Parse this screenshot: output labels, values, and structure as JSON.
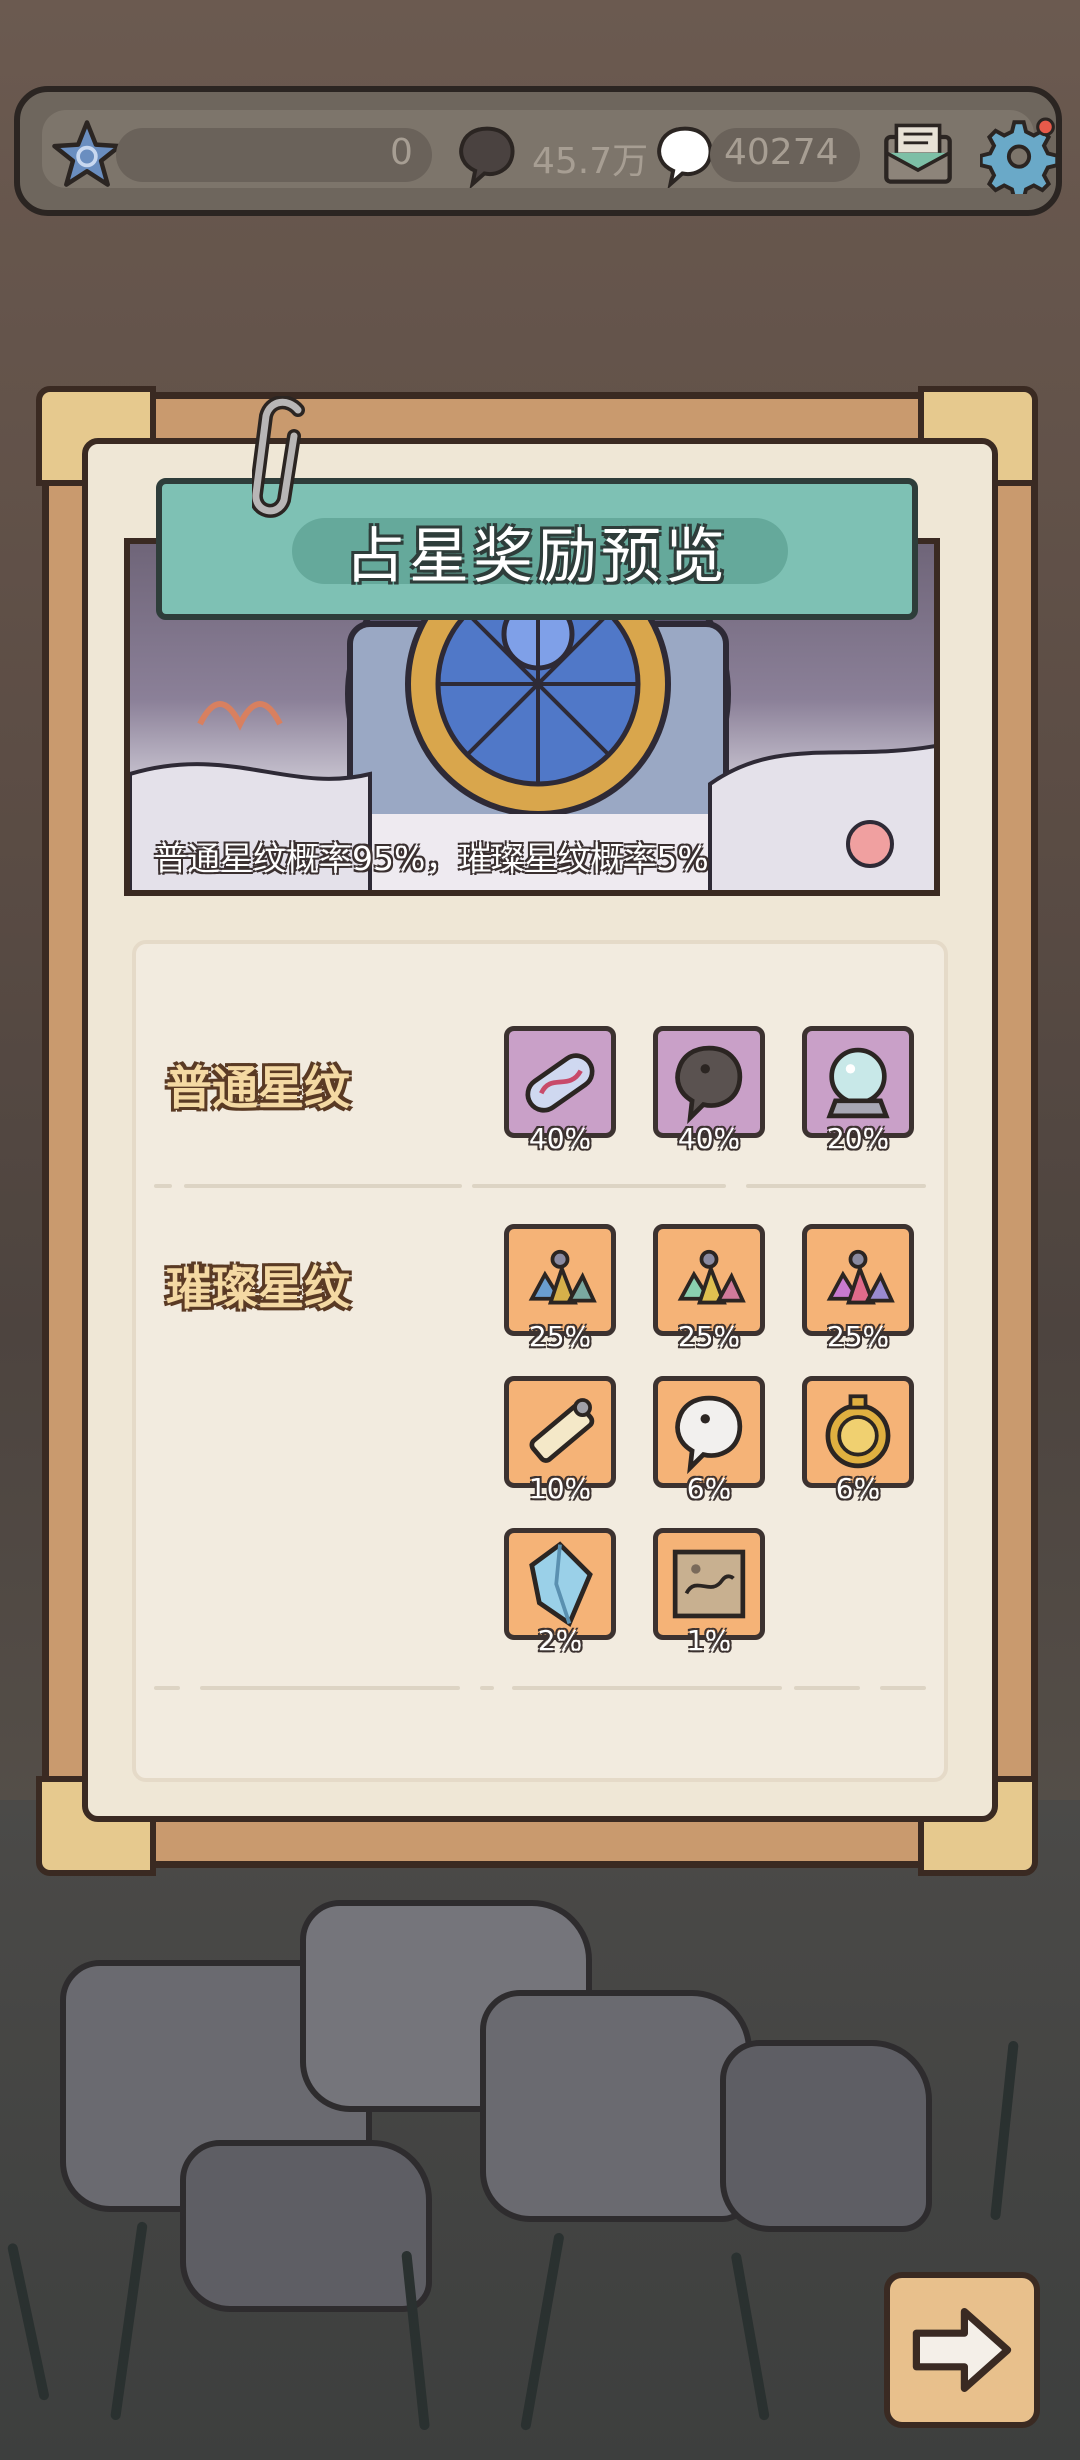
{
  "topbar": {
    "star_count": "0",
    "currency_1": "45.7万",
    "currency_2": "40274",
    "icons": [
      "star-icon",
      "speech-bubble-icon",
      "speech-bubble-icon",
      "mail-icon",
      "gear-icon"
    ]
  },
  "panel": {
    "title": "占星奖励预览",
    "caption": "普通星纹概率95%，璀璨星纹概率5%",
    "rows": [
      {
        "label": "普通星纹",
        "items": [
          {
            "icon": "bandage-icon",
            "percent": "40%"
          },
          {
            "icon": "dark-bubble-icon",
            "percent": "40%"
          },
          {
            "icon": "crystal-ball-icon",
            "percent": "20%"
          }
        ]
      },
      {
        "label": "璀璨星纹",
        "items": [
          {
            "icon": "gem-cluster-icon",
            "percent": "25%"
          },
          {
            "icon": "gem-cluster-icon",
            "percent": "25%"
          },
          {
            "icon": "gem-cluster-icon",
            "percent": "25%"
          },
          {
            "icon": "tube-icon",
            "percent": "10%"
          },
          {
            "icon": "light-bubble-icon",
            "percent": "6%"
          },
          {
            "icon": "gold-compass-icon",
            "percent": "6%"
          },
          {
            "icon": "crystal-icon",
            "percent": "2%"
          },
          {
            "icon": "map-scroll-icon",
            "percent": "1%"
          }
        ]
      }
    ]
  },
  "colors": {
    "common_slot": "#c9a0c8",
    "rare_slot": "#f5b377",
    "title_ribbon": "#7ec1b4",
    "panel_frame": "#c99a6e"
  },
  "next_button_icon": "arrow-right-icon"
}
